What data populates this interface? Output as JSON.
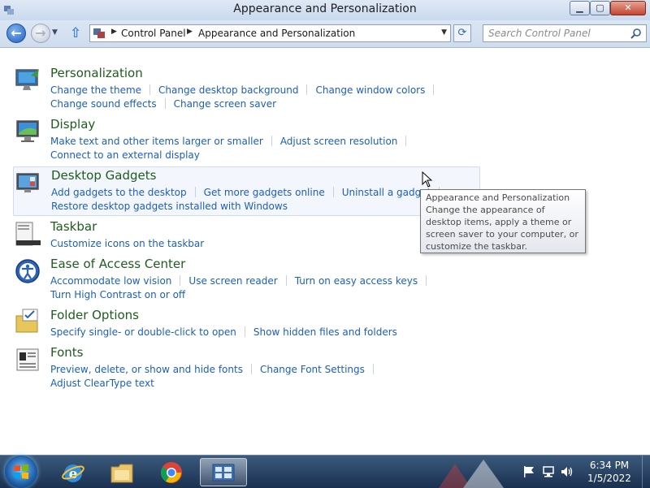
{
  "window": {
    "title": "Appearance and Personalization"
  },
  "nav": {
    "breadcrumbs": [
      "Control Panel",
      "Appearance and Personalization"
    ],
    "search_placeholder": "Search Control Panel"
  },
  "categories": [
    {
      "title": "Personalization",
      "icon": "personalization-icon",
      "lines": [
        [
          "Change the theme",
          "Change desktop background",
          "Change window colors"
        ],
        [
          "Change sound effects",
          "Change screen saver"
        ]
      ]
    },
    {
      "title": "Display",
      "icon": "display-icon",
      "lines": [
        [
          "Make text and other items larger or smaller",
          "Adjust screen resolution"
        ],
        [
          "Connect to an external display"
        ]
      ]
    },
    {
      "title": "Desktop Gadgets",
      "icon": "gadgets-icon",
      "lines": [
        [
          "Add gadgets to the desktop",
          "Get more gadgets online",
          "Uninstall a gadget"
        ],
        [
          "Restore desktop gadgets installed with Windows"
        ]
      ]
    },
    {
      "title": "Taskbar",
      "icon": "taskbar-icon",
      "lines": [
        [
          "Customize icons on the taskbar"
        ]
      ]
    },
    {
      "title": "Ease of Access Center",
      "icon": "ease-of-access-icon",
      "lines": [
        [
          "Accommodate low vision",
          "Use screen reader",
          "Turn on easy access keys"
        ],
        [
          "Turn High Contrast on or off"
        ]
      ]
    },
    {
      "title": "Folder Options",
      "icon": "folder-options-icon",
      "lines": [
        [
          "Specify single- or double-click to open",
          "Show hidden files and folders"
        ]
      ]
    },
    {
      "title": "Fonts",
      "icon": "fonts-icon",
      "lines": [
        [
          "Preview, delete, or show and hide fonts",
          "Change Font Settings",
          "Adjust ClearType text"
        ]
      ]
    }
  ],
  "tooltip": {
    "title": "Appearance and Personalization",
    "body": "Change the appearance of desktop items, apply a theme or screen saver to your computer, or customize the taskbar."
  },
  "taskbar": {
    "items": [
      "internet-explorer-icon",
      "windows-explorer-icon",
      "chrome-icon",
      "control-panel-icon"
    ],
    "time": "6:34 PM",
    "date": "1/5/2022"
  }
}
